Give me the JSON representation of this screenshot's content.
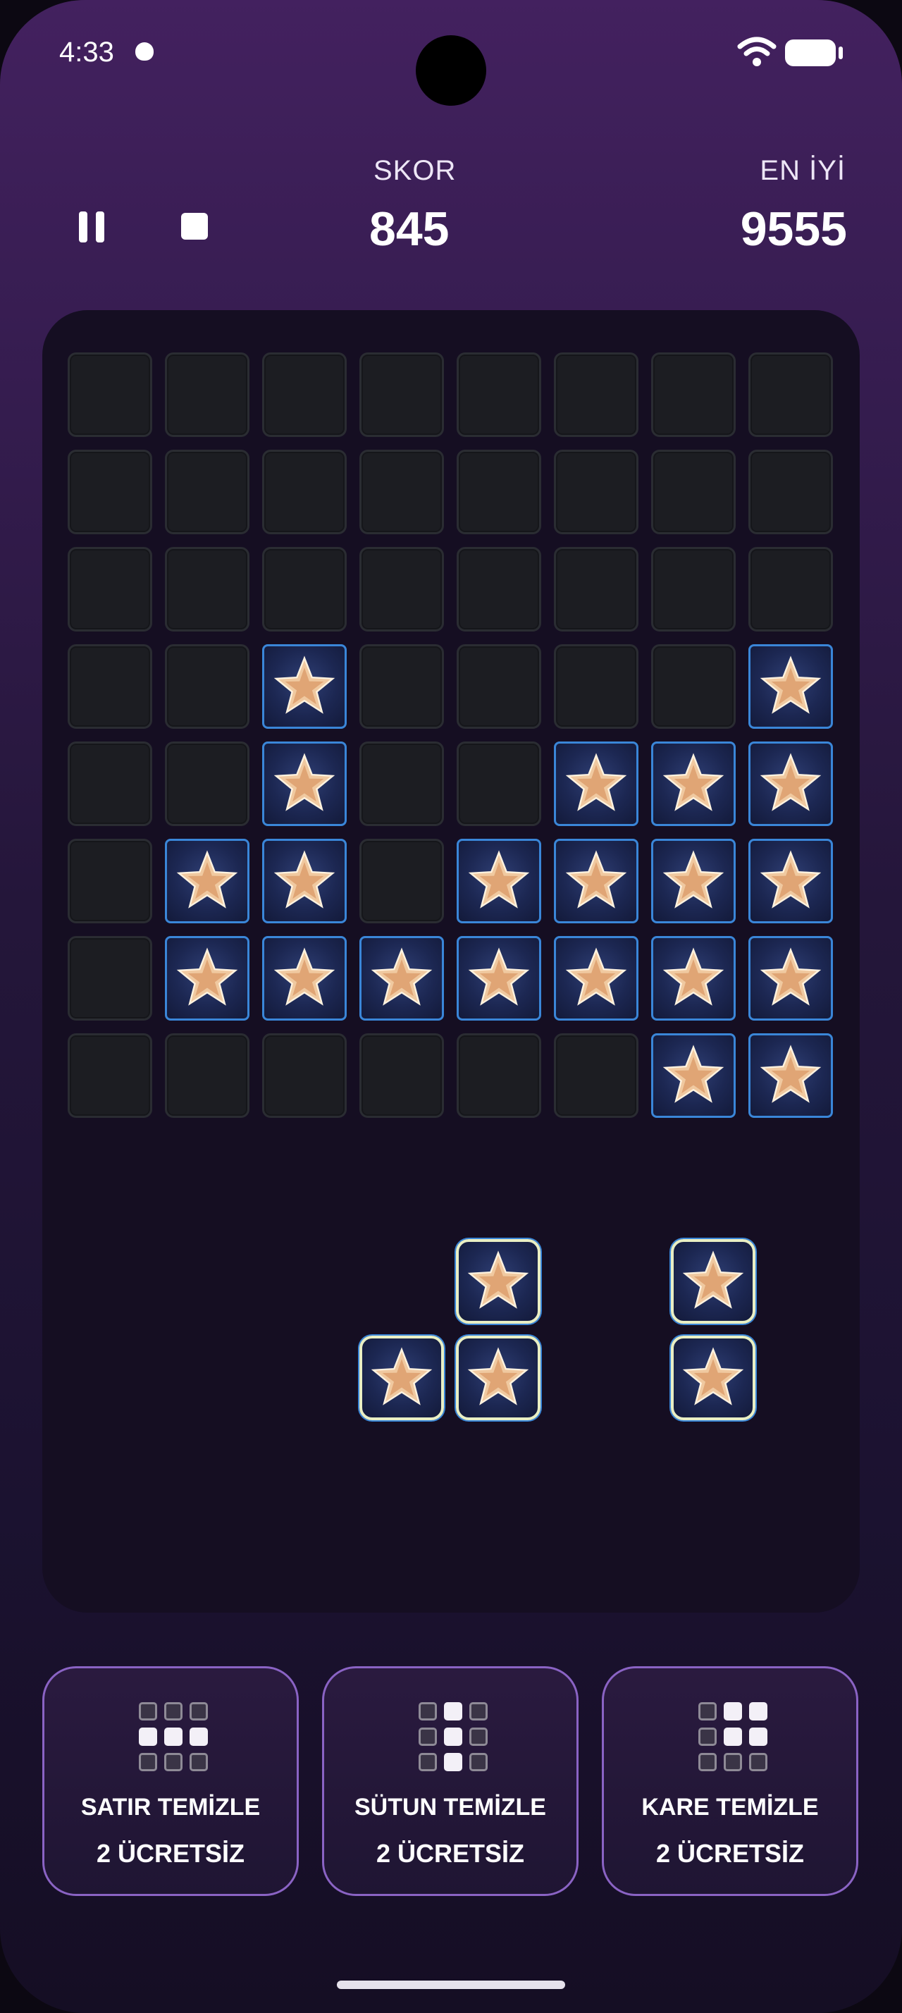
{
  "status_bar": {
    "time": "4:33"
  },
  "header": {
    "score_label": "SKOR",
    "score_value": "845",
    "best_label": "EN İYİ",
    "best_value": "9555"
  },
  "board": {
    "rows": 8,
    "cols": 8,
    "filled": [
      [
        0,
        0,
        0,
        0,
        0,
        0,
        0,
        0
      ],
      [
        0,
        0,
        0,
        0,
        0,
        0,
        0,
        0
      ],
      [
        0,
        0,
        0,
        0,
        0,
        0,
        0,
        0
      ],
      [
        0,
        0,
        1,
        0,
        0,
        0,
        0,
        1
      ],
      [
        0,
        0,
        1,
        0,
        0,
        1,
        1,
        1
      ],
      [
        0,
        1,
        1,
        0,
        1,
        1,
        1,
        1
      ],
      [
        0,
        1,
        1,
        1,
        1,
        1,
        1,
        1
      ],
      [
        0,
        0,
        0,
        0,
        0,
        0,
        1,
        1
      ]
    ],
    "tile_icon": "star-icon"
  },
  "pieces": [
    {
      "name": "l-piece",
      "cells": [
        [
          0,
          1
        ],
        [
          1,
          0
        ],
        [
          1,
          1
        ]
      ]
    },
    {
      "name": "vertical-domino",
      "cells": [
        [
          0,
          0
        ],
        [
          1,
          0
        ]
      ]
    }
  ],
  "powerups": [
    {
      "title": "SATIR TEMİZLE",
      "sub": "2 ÜCRETSİZ",
      "pattern": [
        0,
        0,
        0,
        1,
        1,
        1,
        0,
        0,
        0
      ]
    },
    {
      "title": "SÜTUN TEMİZLE",
      "sub": "2 ÜCRETSİZ",
      "pattern": [
        0,
        1,
        0,
        0,
        1,
        0,
        0,
        1,
        0
      ]
    },
    {
      "title": "KARE TEMİZLE",
      "sub": "2 ÜCRETSİZ",
      "pattern": [
        0,
        1,
        1,
        0,
        1,
        1,
        0,
        0,
        0
      ]
    }
  ],
  "colors": {
    "accent_border": "#3a86d8",
    "piece_outline": "#e9efc4",
    "powerup_border": "#8a63c4"
  }
}
